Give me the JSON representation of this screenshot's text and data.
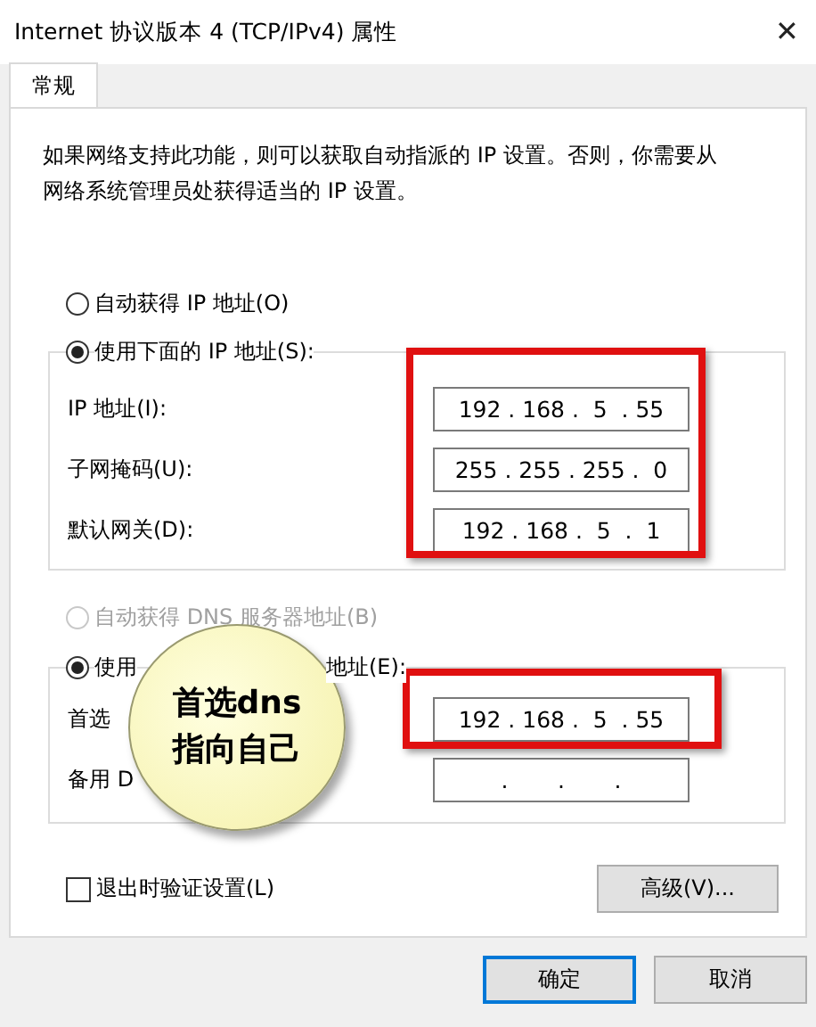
{
  "window": {
    "title": "Internet 协议版本 4 (TCP/IPv4) 属性",
    "close": "✕"
  },
  "tabs": [
    {
      "label": "常规",
      "selected": true
    }
  ],
  "description": "如果网络支持此功能，则可以获取自动指派的 IP 设置。否则，你需要从网络系统管理员处获得适当的 IP 设置。",
  "ip_mode": [
    {
      "label": "自动获得 IP 地址(O)",
      "selected": false,
      "disabled": false
    },
    {
      "label": "使用下面的 IP 地址(S):",
      "selected": true,
      "disabled": false
    }
  ],
  "ip_fields": [
    {
      "label": "IP 地址(I):",
      "value": "192 . 168 .  5  . 55"
    },
    {
      "label": "子网掩码(U):",
      "value": "255 . 255 . 255 .  0"
    },
    {
      "label": "默认网关(D):",
      "value": "192 . 168 .  5  .  1"
    }
  ],
  "dns_auto": {
    "label": "自动获得 DNS 服务器地址(B)",
    "selected": false,
    "disabled": true
  },
  "dns_manual": {
    "label_start": "使用",
    "label_end": "地址(E):",
    "selected": true
  },
  "dns_fields": [
    {
      "label": "首选",
      "value": "192 . 168 .  5  . 55"
    },
    {
      "label": "备用 D",
      "value": "   .       .       .   "
    }
  ],
  "validate": {
    "label": "退出时验证设置(L)",
    "checked": false
  },
  "advanced_button": "高级(V)...",
  "buttons": [
    {
      "label": "确定",
      "default": true
    },
    {
      "label": "取消",
      "default": false
    }
  ],
  "callout": "首选dns指向自己"
}
